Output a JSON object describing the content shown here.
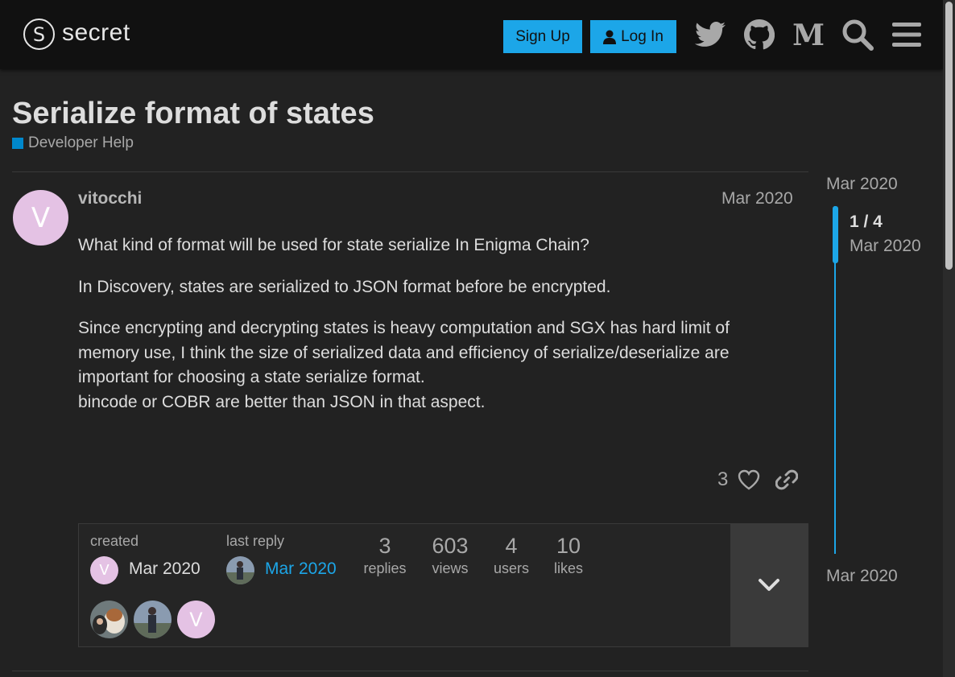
{
  "header": {
    "logo_mark": "S",
    "logo_text": "secret",
    "signup_label": "Sign Up",
    "login_label": "Log In",
    "icons": [
      "twitter-icon",
      "github-icon",
      "medium-icon",
      "search-icon",
      "hamburger-menu-icon"
    ]
  },
  "topic": {
    "title": "Serialize format of states",
    "category": "Developer Help",
    "category_color": "#0088cc"
  },
  "post": {
    "avatar_letter": "V",
    "username": "vitocchi",
    "date": "Mar 2020",
    "paragraphs": [
      "What kind of format will be used for state serialize In Enigma Chain?",
      "In Discovery, states are serialized to JSON format before be encrypted.",
      "Since encrypting and decrypting states is heavy computation and SGX has hard limit of memory use, I think the size of serialized data and efficiency of serialize/deserialize are important for choosing a state serialize format.\nbincode or COBR are better than JSON in that aspect."
    ],
    "like_count": "3"
  },
  "topic_map": {
    "created_label": "created",
    "created_avatar_letter": "V",
    "created_date": "Mar 2020",
    "last_reply_label": "last reply",
    "last_reply_date": "Mar 2020",
    "stats": [
      {
        "num": "3",
        "label": "replies"
      },
      {
        "num": "603",
        "label": "views"
      },
      {
        "num": "4",
        "label": "users"
      },
      {
        "num": "10",
        "label": "likes"
      }
    ],
    "participant_letter": "V"
  },
  "timeline": {
    "top_date": "Mar 2020",
    "position": "1 / 4",
    "position_date": "Mar 2020",
    "bottom_date": "Mar 2020"
  },
  "colors": {
    "accent": "#1ca6e8",
    "avatar_bg": "#e4c2e4",
    "background": "#222222",
    "header_bg": "#111111"
  }
}
